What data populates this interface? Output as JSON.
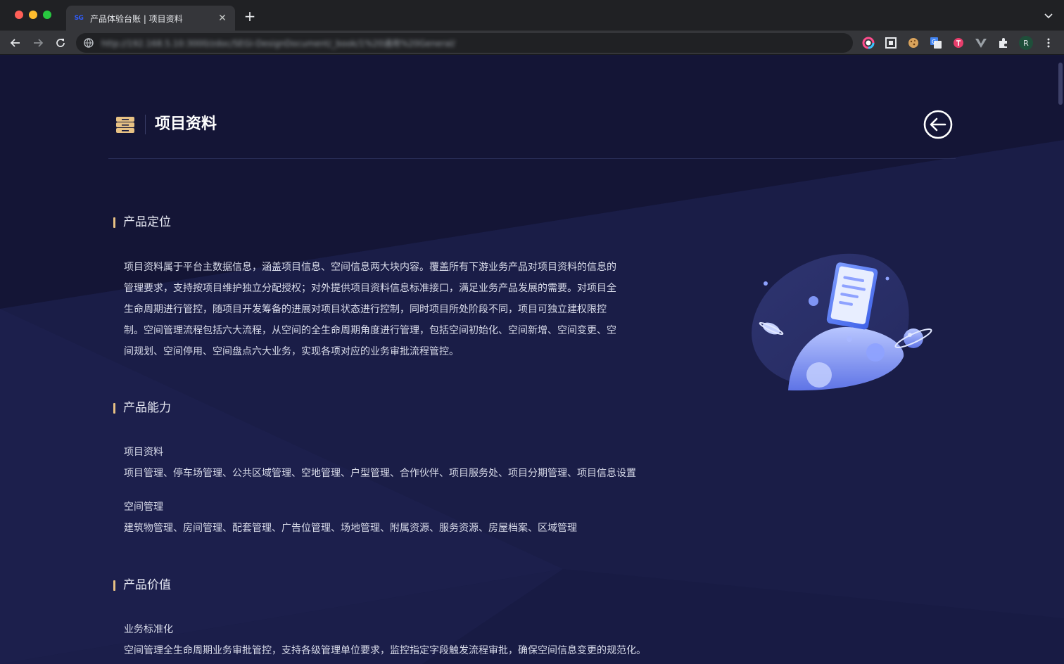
{
  "browser": {
    "tab": {
      "favicon_text": "SG",
      "title": "产品体验台账 | 项目资料",
      "close": "✕"
    },
    "new_tab": "+",
    "url": "http://192.168.5.10:3000/zdoc/SEGi-DesignDocument/_book/1%20通用%20General/"
  },
  "header": {
    "title": "项目资料",
    "accent_color": "#e7c184"
  },
  "sections": {
    "positioning": {
      "title": "产品定位",
      "lines": [
        "项目资料属于平台主数据信息，涵盖项目信息、空间信息两大块内容。覆盖所有下游业务产品对项目资料的信息的",
        "管理要求，支持按项目维护独立分配授权；对外提供项目资料信息标准接口，满足业务产品发展的需要。对项目全",
        "生命周期进行管控，随项目开发筹备的进展对项目状态进行控制，同时项目所处阶段不同，项目可独立建权限控",
        "制。空间管理流程包括六大流程，从空间的全生命周期角度进行管理，包括空间初始化、空间新增、空间变更、空",
        "间规划、空间停用、空间盘点六大业务，实现各项对应的业务审批流程管控。"
      ]
    },
    "capability": {
      "title": "产品能力",
      "items": [
        {
          "title": "项目资料",
          "body": "项目管理、停车场管理、公共区域管理、空地管理、户型管理、合作伙伴、项目服务处、项目分期管理、项目信息设置"
        },
        {
          "title": "空间管理",
          "body": "建筑物管理、房间管理、配套管理、广告位管理、场地管理、附属资源、服务资源、房屋档案、区域管理"
        }
      ]
    },
    "value": {
      "title": "产品价值",
      "items": [
        {
          "title": "业务标准化",
          "body": "空间管理全生命周期业务审批管控，支持各级管理单位要求，监控指定字段触发流程审批，确保空间信息变更的规范化。"
        }
      ]
    }
  }
}
